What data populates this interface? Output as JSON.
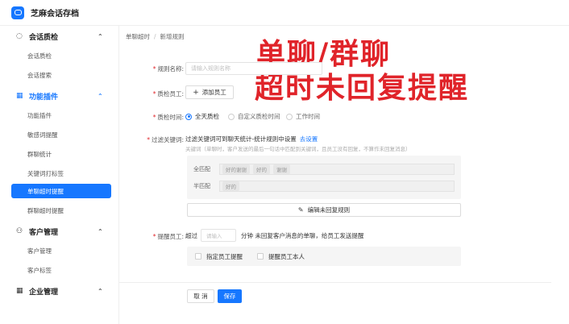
{
  "app": {
    "title": "芝麻会话存档"
  },
  "sidebar": {
    "groups": [
      {
        "label": "会话质检",
        "icon": "chat-bubble-icon",
        "items": [
          "会话质检",
          "会话搜索"
        ]
      },
      {
        "label": "功能插件",
        "icon": "grid-icon",
        "items": [
          "功能插件",
          "敏感词提醒",
          "群聊统计",
          "关键词打标签",
          "单聊超时提醒",
          "群聊超时提醒"
        ],
        "selected": "单聊超时提醒"
      },
      {
        "label": "客户管理",
        "icon": "users-icon",
        "items": [
          "客户管理",
          "客户标签"
        ]
      },
      {
        "label": "企业管理",
        "icon": "grid-icon",
        "items": []
      }
    ]
  },
  "breadcrumb": {
    "parent": "单聊超时",
    "separator": "/",
    "current": "新增规则"
  },
  "overlay": {
    "line1": "单聊/群聊",
    "line2": "超时未回复提醒"
  },
  "form": {
    "rule_name": {
      "label": "规则名称:",
      "placeholder": "请输入规则名称"
    },
    "inspector": {
      "label": "质检员工:",
      "add_button": "添加员工"
    },
    "inspect_time": {
      "label": "质检时间:",
      "options": [
        {
          "label": "全天质检",
          "checked": true
        },
        {
          "label": "自定义质检时间",
          "checked": false
        },
        {
          "label": "工作时间",
          "checked": false
        }
      ]
    },
    "filter_keywords": {
      "label": "过滤关键词:",
      "title": "过滤关键词可到聊天统计-统计规则中设置",
      "link": "去设置",
      "description": "关键词（单聊时，客户发送的最后一句话中匹配到关键词，且员工没有回复，不算作未回复消息）",
      "full_match": {
        "label": "全匹配",
        "tags": [
          "好的谢谢",
          "好的",
          "谢谢"
        ]
      },
      "half_match": {
        "label": "半匹配",
        "tags": [
          "好的"
        ]
      }
    },
    "edit_rule_button": "编辑未回复规则",
    "remind": {
      "label": "提醒员工:",
      "prefix": "超过",
      "placeholder": "请输入",
      "suffix": "分钟 未回复客户消息的单聊，给员工发送提醒",
      "checks": [
        "指定员工提醒",
        "提醒员工本人"
      ]
    }
  },
  "actions": {
    "cancel": "取 消",
    "save": "保存"
  },
  "colors": {
    "primary": "#1677ff",
    "overlay_red": "#e0242a"
  }
}
